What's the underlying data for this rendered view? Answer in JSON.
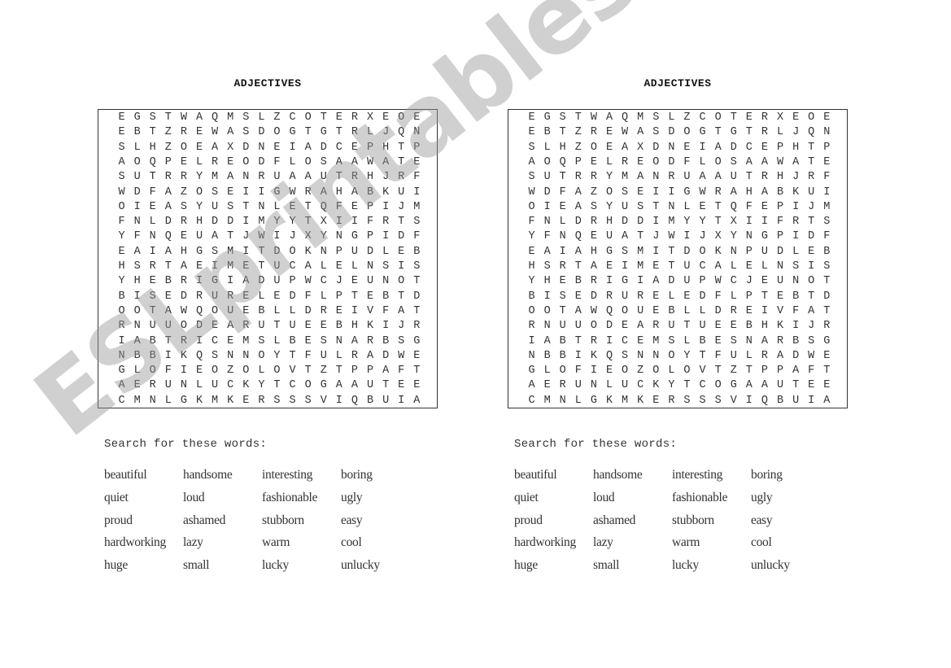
{
  "worksheet": {
    "title": "ADJECTIVES",
    "instructions": "Search for these words:",
    "grid": [
      "EGSTWAQMSLZCOTERXEOE",
      "EBTZREWASDOGTGTRLJQN",
      "SLHZOEAXDNEIADCEPHTP",
      "AOQPELREODFLOSAAWATE",
      "SUTRRYMANRUAAUTRHJRF",
      "WDFAZOSEIIGWRAHABKUI",
      "OIEASYUSTNLETQFEPIJM",
      "FNLDRHDDIMYYTXIIFRTS",
      "YFNQEUATJWIJXYNGPIDF",
      "EAIAHGSMITDOKNPUDLEB",
      "HSRTAEIMETUCALELNSIS",
      "YHEBRIGIADUPWCJEUNOT",
      "BISEDRURELEDFLPTEBTD",
      "OOTAWQOUEBLLDREIVFAT",
      "RNUUODEARUTUEEBHKIJR",
      "IABTRICEMSLBESNARBSG",
      "NBBIKQSNNOYTFULRADWE",
      "GLOFIEOZOLOVTZTPPAFT",
      "AERUNLUCKYTCOGAAUTEE",
      "CMNLGKMKERSSSVIQBUIA"
    ],
    "word_rows": [
      [
        "beautiful",
        "handsome",
        "interesting",
        "boring"
      ],
      [
        "quiet",
        "loud",
        "fashionable",
        "ugly"
      ],
      [
        "proud",
        "ashamed",
        "stubborn",
        "easy"
      ],
      [
        "hardworking",
        "lazy",
        "warm",
        "cool"
      ],
      [
        "huge",
        "small",
        "lucky",
        "unlucky"
      ]
    ]
  },
  "copies": [
    "left",
    "right"
  ],
  "watermark": "ESLprintables.com"
}
